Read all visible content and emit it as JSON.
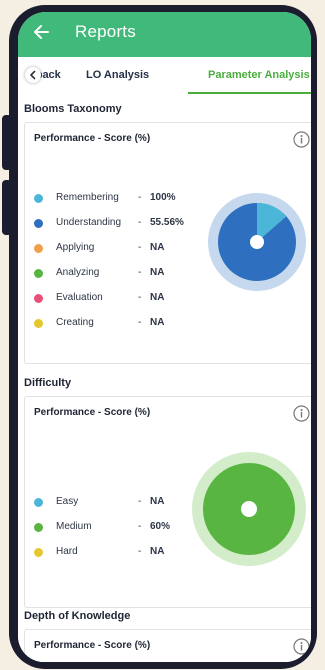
{
  "header": {
    "title": "Reports",
    "back_icon": "arrow-left-icon"
  },
  "tabs": [
    {
      "label": "Feedback",
      "visible_text": "dback",
      "active": false
    },
    {
      "label": "LO Analysis",
      "active": false
    },
    {
      "label": "Parameter Analysis",
      "active": true
    }
  ],
  "colors": {
    "brand_green": "#41b97a",
    "active_tab": "#4aae3f",
    "ring_blue_light": "#c6d8ee",
    "ring_green_light": "#d3ecca",
    "pie_green": "#59b541",
    "pie_blue": "#2f6fbf",
    "pie_light_blue": "#4cb6d9"
  },
  "blooms": {
    "section_title": "Blooms Taxonomy",
    "card_title": "Performance - Score (%)",
    "legend": [
      {
        "label": "Remembering",
        "value": "100%",
        "color": "#4cb6d9"
      },
      {
        "label": "Understanding",
        "value": "55.56%",
        "color": "#2f6fbf"
      },
      {
        "label": "Applying",
        "value": "NA",
        "color": "#f0a04b"
      },
      {
        "label": "Analyzing",
        "value": "NA",
        "color": "#59b541"
      },
      {
        "label": "Evaluation",
        "value": "NA",
        "color": "#e8507a"
      },
      {
        "label": "Creating",
        "value": "NA",
        "color": "#e5c72f"
      }
    ],
    "chart_data": {
      "type": "pie",
      "slices": [
        {
          "label": "Remembering",
          "value": 100
        },
        {
          "label": "Understanding",
          "value": 55.56
        }
      ]
    }
  },
  "difficulty": {
    "section_title": "Difficulty",
    "card_title": "Performance - Score (%)",
    "legend": [
      {
        "label": "Easy",
        "value": "NA",
        "color": "#4cb6d9"
      },
      {
        "label": "Medium",
        "value": "60%",
        "color": "#59b541"
      },
      {
        "label": "Hard",
        "value": "NA",
        "color": "#e5c72f"
      }
    ],
    "chart_data": {
      "type": "pie",
      "slices": [
        {
          "label": "Medium",
          "value": 60
        }
      ]
    }
  },
  "depth": {
    "section_title": "Depth of Knowledge",
    "card_title": "Performance - Score (%)"
  }
}
